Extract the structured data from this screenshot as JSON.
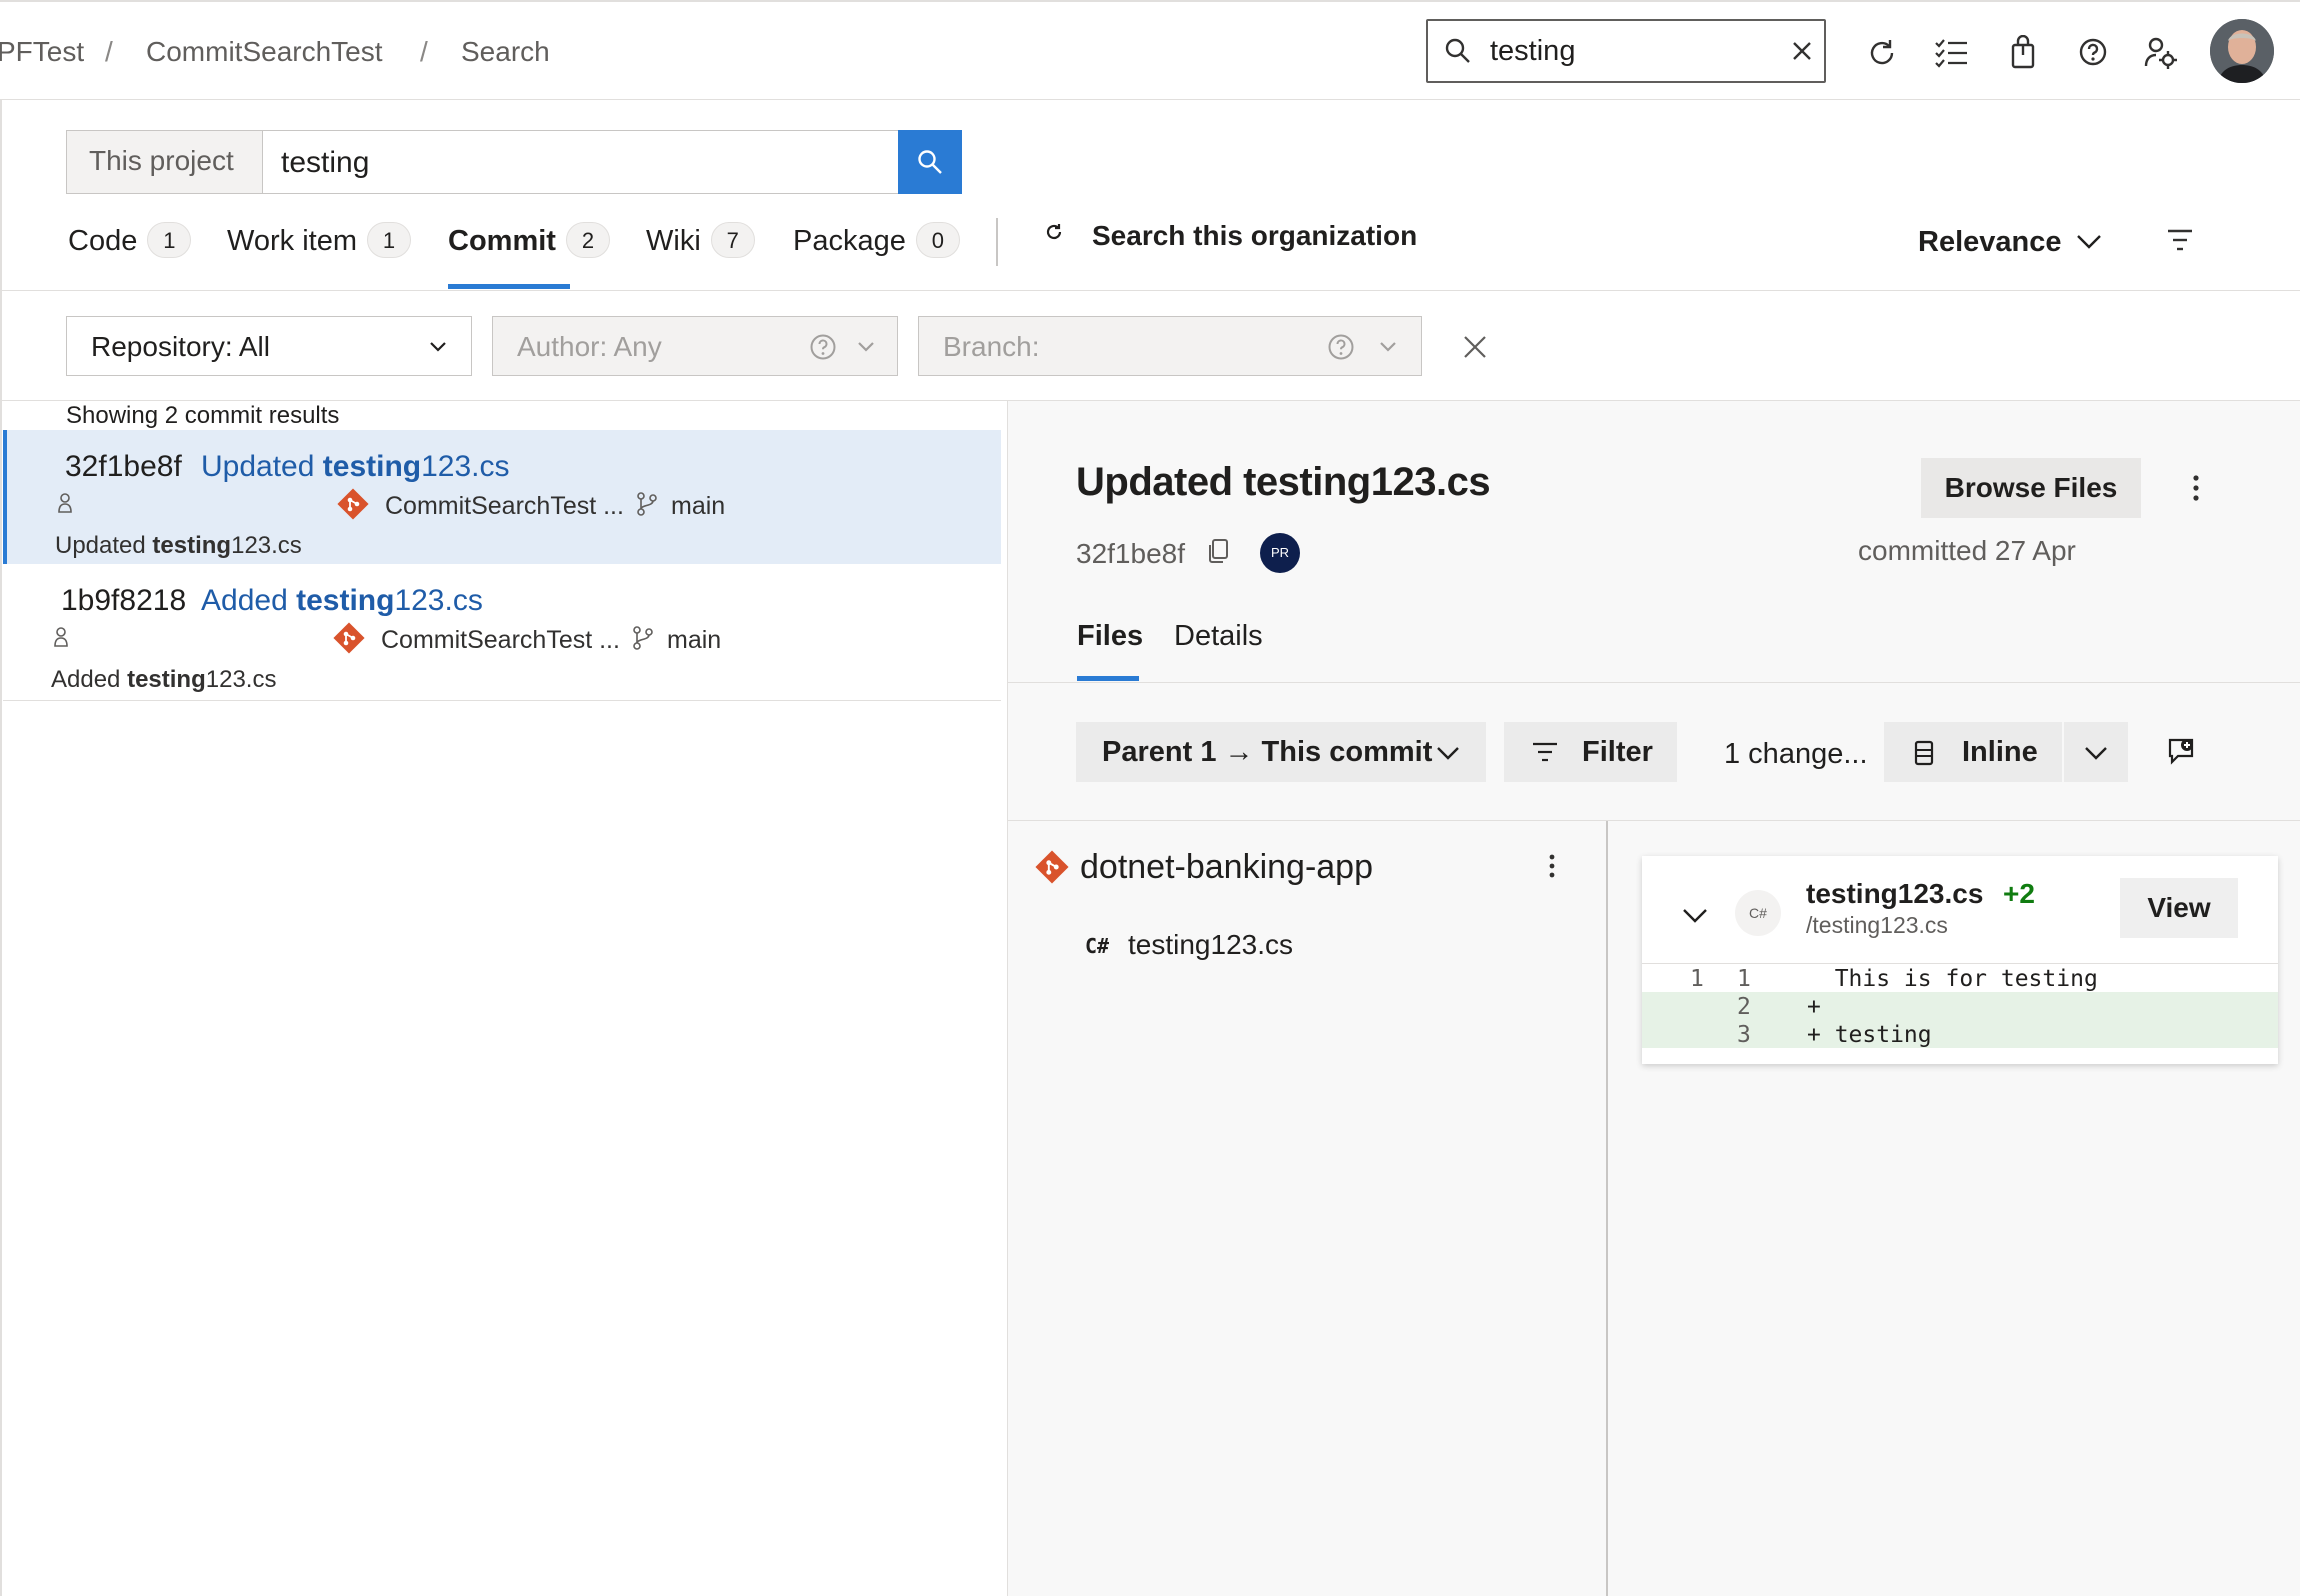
{
  "breadcrumb": {
    "items": [
      "PFTest",
      "CommitSearchTest",
      "Search"
    ],
    "separator": "/"
  },
  "global_search": {
    "value": "testing"
  },
  "topbar_icons": [
    "refresh-icon",
    "task-list-icon",
    "shopping-bag-icon",
    "help-icon",
    "user-settings-icon"
  ],
  "search": {
    "scope": "This project",
    "query": "testing"
  },
  "tabs": [
    {
      "label": "Code",
      "count": "1"
    },
    {
      "label": "Work item",
      "count": "1"
    },
    {
      "label": "Commit",
      "count": "2"
    },
    {
      "label": "Wiki",
      "count": "7"
    },
    {
      "label": "Package",
      "count": "0"
    }
  ],
  "search_org": "Search this organization",
  "sort": {
    "label": "Relevance"
  },
  "filters": {
    "repository": "Repository: All",
    "author": "Author: Any",
    "branch": "Branch:"
  },
  "results": {
    "count_text": "Showing 2 commit results",
    "items": [
      {
        "hash": "32f1be8f",
        "title_prefix": "Updated",
        "title_highlight": "testing",
        "title_suffix": "123.cs",
        "repo": "CommitSearchTest ...",
        "branch": "main",
        "msg_prefix": "Updated",
        "msg_highlight": "testing",
        "msg_suffix": "123.cs"
      },
      {
        "hash": "1b9f8218",
        "title_prefix": "Added",
        "title_highlight": "testing",
        "title_suffix": "123.cs",
        "repo": "CommitSearchTest ...",
        "branch": "main",
        "msg_prefix": "Added",
        "msg_highlight": "testing",
        "msg_suffix": "123.cs"
      }
    ]
  },
  "detail": {
    "title": "Updated testing123.cs",
    "browse_files": "Browse Files",
    "hash": "32f1be8f",
    "author_initials": "PR",
    "committed": "committed 27 Apr",
    "tabs": [
      "Files",
      "Details"
    ],
    "compare_label": "Parent 1 → This commit",
    "filter_label": "Filter",
    "changes_label": "1 change...",
    "view_mode": "Inline",
    "tree": {
      "repo": "dotnet-banking-app",
      "file_lang": "C#",
      "file": "testing123.cs"
    },
    "diff": {
      "file_title": "testing123.cs",
      "additions": "+2",
      "path": "/testing123.cs",
      "lang_badge": "C#",
      "view_label": "View",
      "lines": [
        {
          "old": "1",
          "new": "1",
          "code": "  This is for testing",
          "added": false
        },
        {
          "old": "",
          "new": "2",
          "code": "+",
          "added": true
        },
        {
          "old": "",
          "new": "3",
          "code": "+ testing",
          "added": true
        }
      ]
    }
  },
  "colors": {
    "accent": "#2a7bd4",
    "link": "#1f5ca8",
    "git_orange": "#d9532c",
    "added_green": "#107c10",
    "selected_row": "#e3ecf7"
  }
}
